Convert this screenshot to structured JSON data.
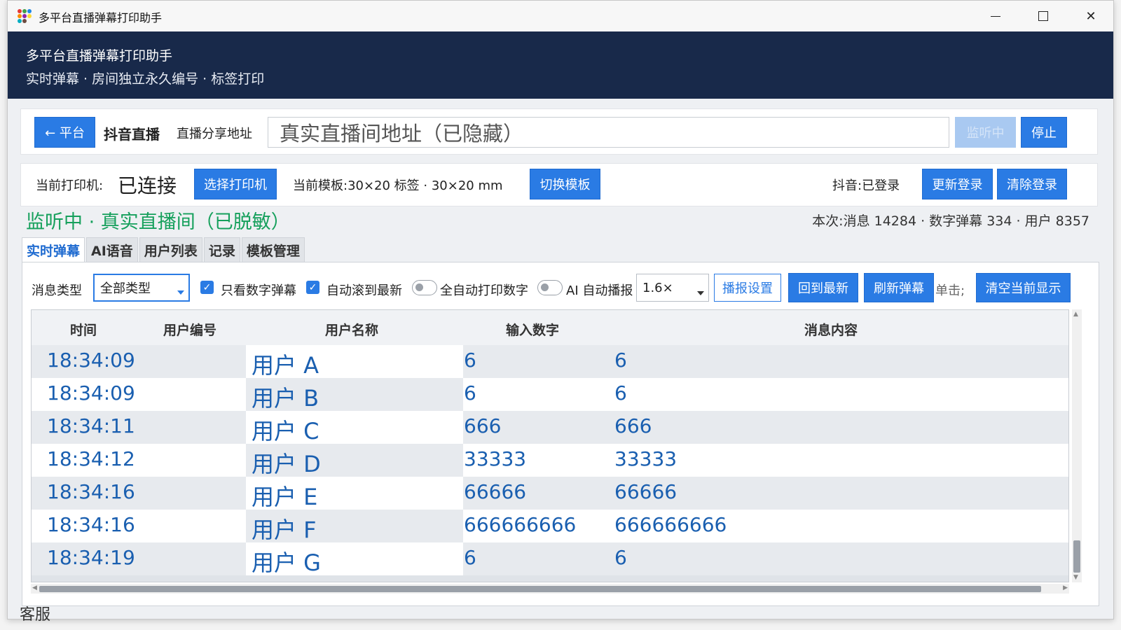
{
  "window": {
    "title": "多平台直播弹幕打印助手",
    "minimize": "—",
    "maximize": "☐",
    "close": "✕"
  },
  "header": {
    "title": "多平台直播弹幕打印助手",
    "subtitle": "实时弹幕 · 房间独立永久编号 · 标签打印"
  },
  "row1": {
    "back_button": "← 平台",
    "platform": "抖音直播",
    "url_label": "直播分享地址",
    "url_value": "真实直播间地址（已隐藏）",
    "listening_button": "监听中",
    "stop_button": "停止"
  },
  "row2": {
    "printer_label": "当前打印机:",
    "printer_status": "已连接",
    "select_printer_button": "选择打印机",
    "template_label": "当前模板:30×20 标签 · 30×20 mm",
    "switch_template_button": "切换模板",
    "login_status": "抖音:已登录",
    "update_login_button": "更新登录",
    "clear_login_button": "清除登录"
  },
  "status": {
    "listening_text": "监听中 · 真实直播间（已脱敏）",
    "stats": "本次:消息 14284 · 数字弹幕 334 · 用户 8357"
  },
  "tabs": [
    "实时弹幕",
    "AI语音",
    "用户列表",
    "记录",
    "模板管理"
  ],
  "toolbar": {
    "type_label": "消息类型",
    "type_value": "全部类型",
    "only_numbers": "只看数字弹幕",
    "auto_scroll": "自动滚到最新",
    "auto_print": "全自动打印数字",
    "ai_broadcast": "AI 自动播报",
    "speed_value": "1.6×",
    "broadcast_settings": "播报设置",
    "back_latest": "回到最新",
    "refresh": "刷新弹幕",
    "single_click_hint": "单击;",
    "clear_display": "清空当前显示"
  },
  "table": {
    "headers": [
      "时间",
      "用户编号",
      "用户名称",
      "输入数字",
      "消息内容"
    ],
    "rows": [
      {
        "time": "18:34:09",
        "user_id": "",
        "name": "用户 A",
        "number": "6",
        "message": "6"
      },
      {
        "time": "18:34:09",
        "user_id": "",
        "name": "用户 B",
        "number": "6",
        "message": "6"
      },
      {
        "time": "18:34:11",
        "user_id": "",
        "name": "用户 C",
        "number": "666",
        "message": "666"
      },
      {
        "time": "18:34:12",
        "user_id": "",
        "name": "用户 D",
        "number": "33333",
        "message": "33333"
      },
      {
        "time": "18:34:16",
        "user_id": "",
        "name": "用户 E",
        "number": "66666",
        "message": "66666"
      },
      {
        "time": "18:34:16",
        "user_id": "",
        "name": "用户 F",
        "number": "666666666",
        "message": "666666666"
      },
      {
        "time": "18:34:19",
        "user_id": "",
        "name": "用户 G",
        "number": "6",
        "message": "6"
      }
    ]
  },
  "bottom": {
    "peek_text": "客服"
  },
  "colors": {
    "header_bg": "#18294a",
    "accent": "#2a7be4",
    "status_green": "#16a05c",
    "cell_text": "#1a5fb0"
  }
}
